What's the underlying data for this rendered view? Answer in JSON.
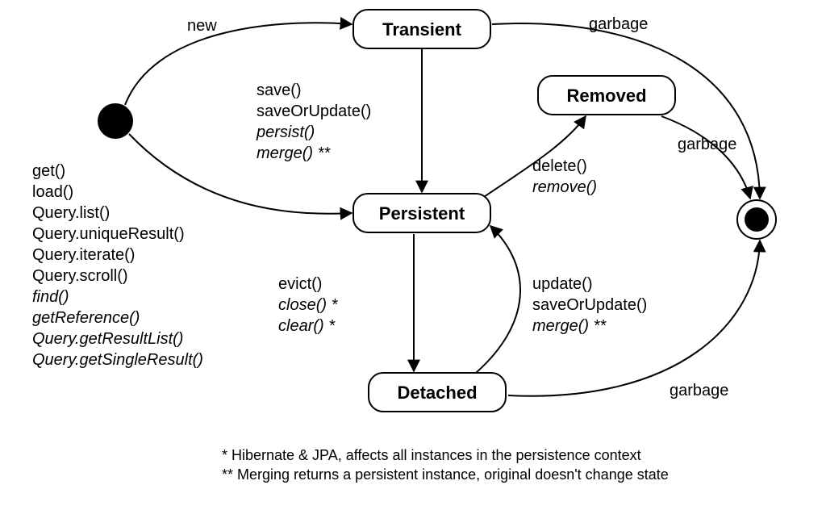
{
  "states": {
    "transient": "Transient",
    "persistent": "Persistent",
    "detached": "Detached",
    "removed": "Removed"
  },
  "edges": {
    "initial_to_transient": "new",
    "transient_to_final": "garbage",
    "removed_to_final": "garbage",
    "detached_to_final": "garbage",
    "transient_to_persistent": [
      {
        "text": "save()",
        "italic": false
      },
      {
        "text": "saveOrUpdate()",
        "italic": false
      },
      {
        "text": "persist()",
        "italic": true
      },
      {
        "text": "merge() **",
        "italic": true
      }
    ],
    "initial_to_persistent": [
      {
        "text": "get()",
        "italic": false
      },
      {
        "text": "load()",
        "italic": false
      },
      {
        "text": "Query.list()",
        "italic": false
      },
      {
        "text": "Query.uniqueResult()",
        "italic": false
      },
      {
        "text": "Query.iterate()",
        "italic": false
      },
      {
        "text": "Query.scroll()",
        "italic": false
      },
      {
        "text": "find()",
        "italic": true
      },
      {
        "text": "getReference()",
        "italic": true
      },
      {
        "text": "Query.getResultList()",
        "italic": true
      },
      {
        "text": "Query.getSingleResult()",
        "italic": true
      }
    ],
    "persistent_to_detached": [
      {
        "text": "evict()",
        "italic": false
      },
      {
        "text": "close() *",
        "italic": true
      },
      {
        "text": "clear() *",
        "italic": true
      }
    ],
    "detached_to_persistent": [
      {
        "text": "update()",
        "italic": false
      },
      {
        "text": "saveOrUpdate()",
        "italic": false
      },
      {
        "text": "merge() **",
        "italic": true
      }
    ],
    "persistent_to_removed": [
      {
        "text": "delete()",
        "italic": false
      },
      {
        "text": "remove()",
        "italic": true
      }
    ]
  },
  "footnotes": [
    "* Hibernate & JPA, affects all instances in the persistence context",
    "** Merging returns a persistent instance, original doesn't change state"
  ]
}
